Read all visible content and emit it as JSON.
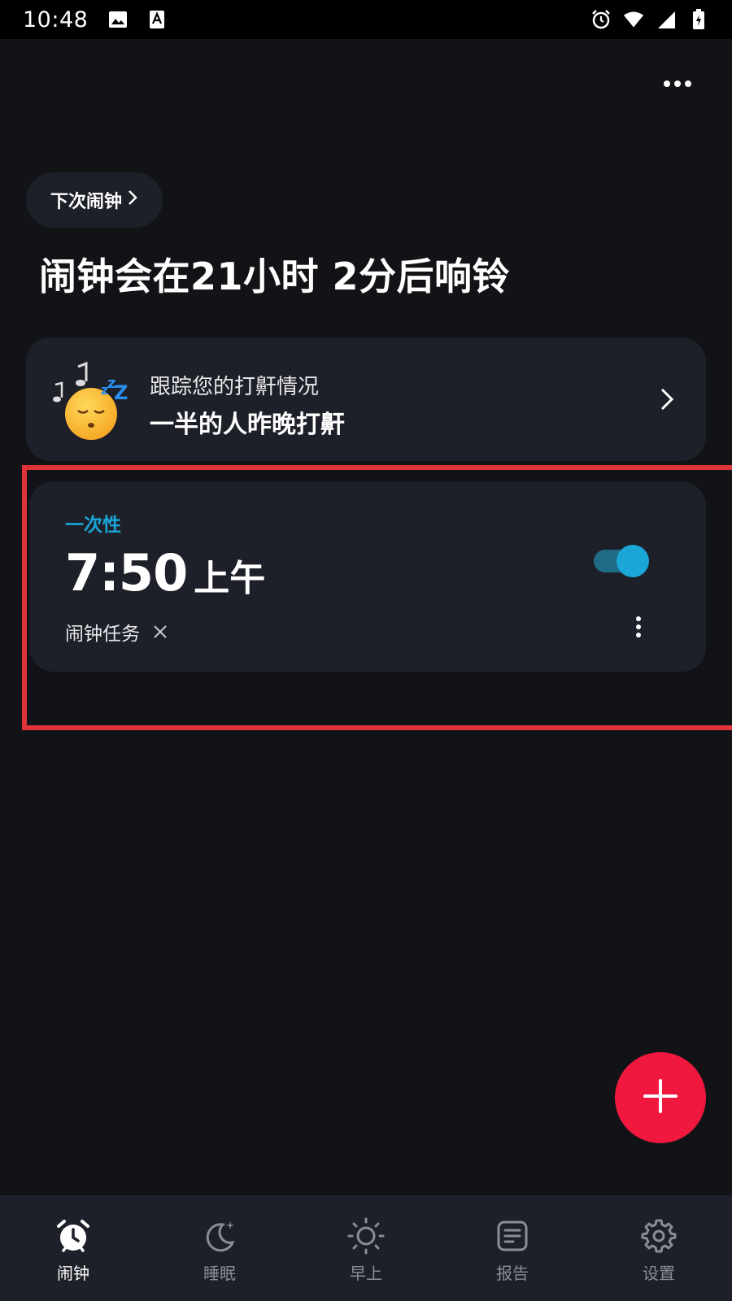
{
  "status_bar": {
    "time": "10:48",
    "icons": [
      "image-icon",
      "a-icon",
      "alarm-icon",
      "wifi-icon",
      "signal-icon",
      "battery-icon"
    ]
  },
  "header": {
    "more_icon": "more-horizontal-icon"
  },
  "next_alarm": {
    "label": "下次闹钟",
    "chevron": "chevron-right-icon"
  },
  "headline": "闹钟会在21小时 2分后响铃",
  "snore_card": {
    "subtitle": "跟踪您的打鼾情况",
    "title": "一半的人昨晚打鼾",
    "icon": "sleeping-emoji-icon"
  },
  "alarm": {
    "repeat": "一次性",
    "time": "7:50",
    "ampm": "上午",
    "enabled": true,
    "mission": "闹钟任务",
    "accent_color": "#1aa6d6"
  },
  "fab": {
    "icon": "plus-icon",
    "color": "#f0183f"
  },
  "bottom_nav": {
    "items": [
      {
        "label": "闹钟",
        "icon": "alarm-clock-icon",
        "active": true
      },
      {
        "label": "睡眠",
        "icon": "moon-icon",
        "active": false
      },
      {
        "label": "早上",
        "icon": "sun-icon",
        "active": false
      },
      {
        "label": "报告",
        "icon": "report-icon",
        "active": false
      },
      {
        "label": "设置",
        "icon": "gear-icon",
        "active": false
      }
    ]
  }
}
